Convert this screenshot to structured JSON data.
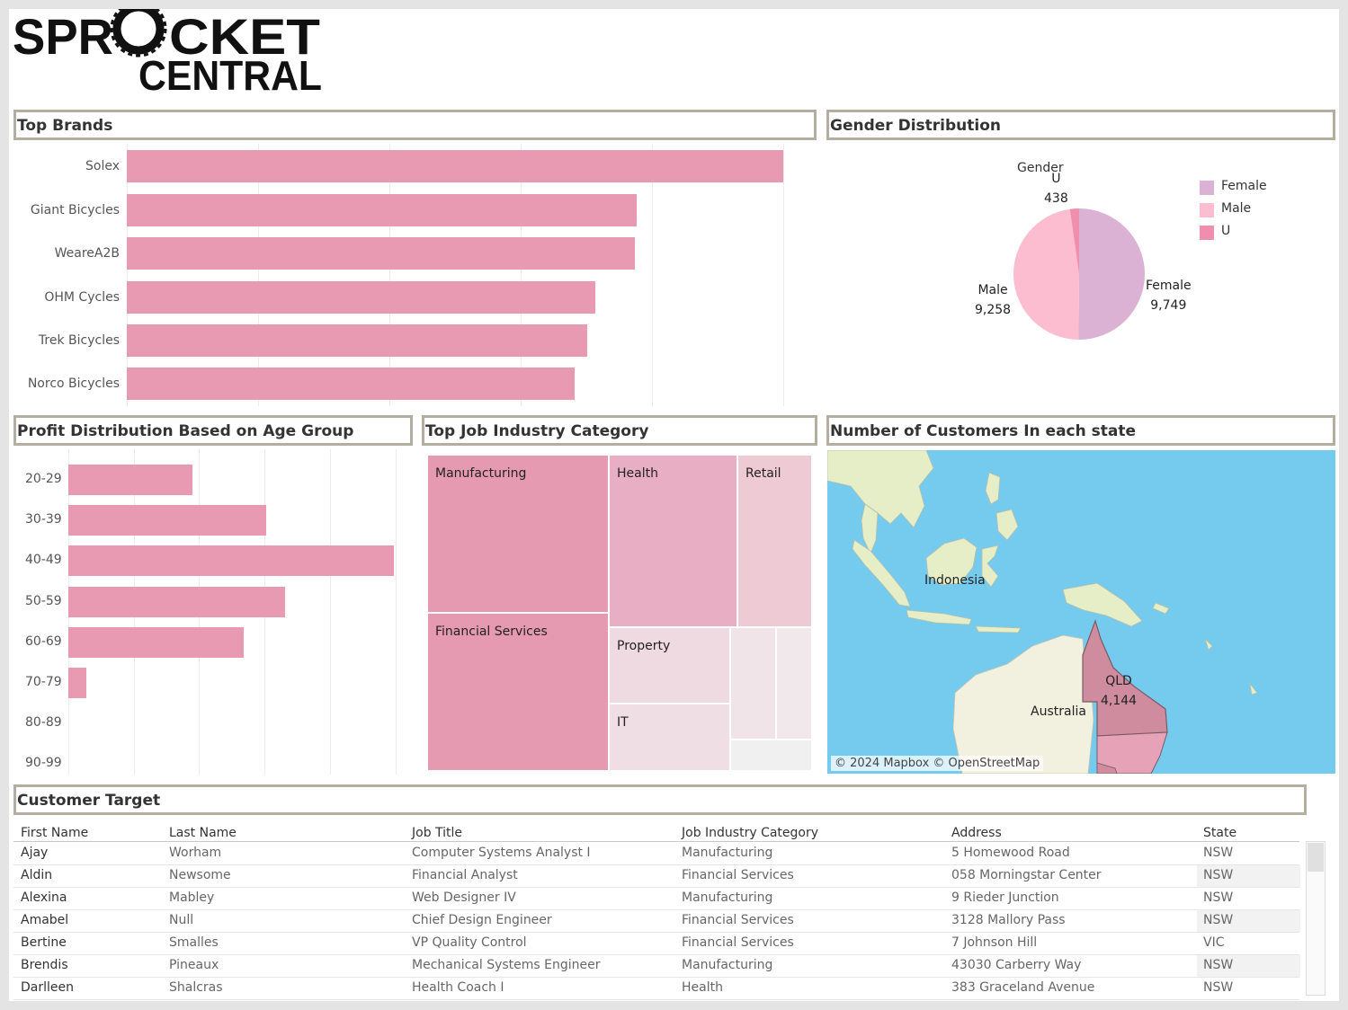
{
  "logo": {
    "line1": "SPROCKET",
    "line2": "CENTRAL"
  },
  "top_brands": {
    "title": "Top Brands",
    "chart_data": {
      "type": "bar",
      "categories": [
        "Solex",
        "Giant Bicycles",
        "WeareA2B",
        "OHM Cycles",
        "Trek Bicycles",
        "Norco Bicycles"
      ],
      "values": [
        100,
        77.7,
        77.4,
        71.4,
        70.2,
        68.3
      ],
      "xlim": [
        0,
        105
      ],
      "grid": true
    }
  },
  "gender": {
    "title": "Gender Distribution",
    "legend_title": "Gender",
    "legend": [
      "Female",
      "Male",
      "U"
    ],
    "colors": {
      "Female": "#dbb2d3",
      "Male": "#fdbdd1",
      "U": "#f08eae"
    },
    "chart_data": {
      "type": "pie",
      "categories": [
        "Female",
        "Male",
        "U"
      ],
      "values": [
        9749,
        9258,
        438
      ],
      "labels": [
        "9,749",
        "9,258",
        "438"
      ]
    }
  },
  "age": {
    "title": "Profit Distribution Based on Age Group",
    "chart_data": {
      "type": "bar",
      "categories": [
        "20-29",
        "30-39",
        "40-49",
        "50-59",
        "60-69",
        "70-79",
        "80-89",
        "90-99"
      ],
      "values": [
        38.1,
        60.8,
        100,
        66.6,
        53.7,
        5.5,
        0,
        0
      ],
      "xlim": [
        0,
        106
      ],
      "grid": true
    }
  },
  "industry": {
    "title": "Top Job Industry Category",
    "chart_data": {
      "type": "treemap",
      "categories": [
        "Manufacturing",
        "Financial Services",
        "Health",
        "Retail",
        "Property",
        "IT"
      ]
    },
    "cells": [
      {
        "label": "Manufacturing",
        "color": "#e69ab2"
      },
      {
        "label": "Financial Services",
        "color": "#e69ab2"
      },
      {
        "label": "Health",
        "color": "#e8afc4"
      },
      {
        "label": "Retail",
        "color": "#eecad5"
      },
      {
        "label": "Property",
        "color": "#efdae1"
      },
      {
        "label": "IT",
        "color": "#efdfe4"
      },
      {
        "label": "",
        "color": "#f0e4e8"
      },
      {
        "label": "",
        "color": "#f1e8eb"
      },
      {
        "label": "",
        "color": "#f0f0f0"
      }
    ]
  },
  "map": {
    "title": "Number of Customers In each state",
    "labels": {
      "indonesia": "Indonesia",
      "australia": "Australia",
      "qld_name": "QLD",
      "qld_value": "4,144"
    },
    "attribution": "© 2024 Mapbox © OpenStreetMap",
    "colors": {
      "sea": "#74cbee",
      "land": "#f2f0df",
      "qld": "#cf8c9e",
      "nsw": "#e6a2b6"
    }
  },
  "customer_target": {
    "title": "Customer Target",
    "columns": [
      "First Name",
      "Last Name",
      "Job Title",
      "Job Industry Category",
      "Address",
      "State"
    ],
    "rows": [
      [
        "Ajay",
        "Worham",
        "Computer Systems Analyst I",
        "Manufacturing",
        "5 Homewood Road",
        "NSW"
      ],
      [
        "Aldin",
        "Newsome",
        "Financial Analyst",
        "Financial Services",
        "058 Morningstar Center",
        "NSW"
      ],
      [
        "Alexina",
        "Mabley",
        "Web Designer IV",
        "Manufacturing",
        "9 Rieder Junction",
        "NSW"
      ],
      [
        "Amabel",
        "Null",
        "Chief Design Engineer",
        "Financial Services",
        "3128 Mallory Pass",
        "NSW"
      ],
      [
        "Bertine",
        "Smalles",
        "VP Quality Control",
        "Financial Services",
        "7 Johnson Hill",
        "VIC"
      ],
      [
        "Brendis",
        "Pineaux",
        "Mechanical Systems Engineer",
        "Manufacturing",
        "43030 Carberry Way",
        "NSW"
      ],
      [
        "Darlleen",
        "Shalcras",
        "Health Coach I",
        "Health",
        "383 Graceland Avenue",
        "NSW"
      ]
    ]
  }
}
